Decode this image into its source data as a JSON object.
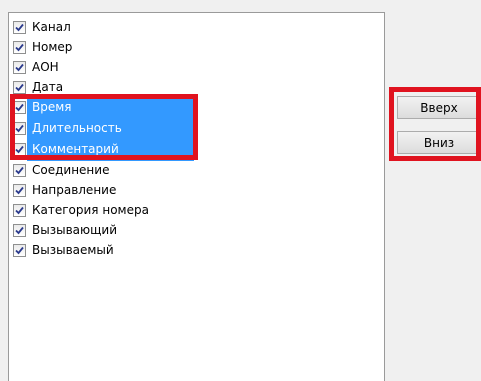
{
  "list": {
    "items": [
      {
        "label": "Канал",
        "checked": true,
        "selected": false
      },
      {
        "label": "Номер",
        "checked": true,
        "selected": false
      },
      {
        "label": "АОН",
        "checked": true,
        "selected": false
      },
      {
        "label": "Дата",
        "checked": true,
        "selected": false
      },
      {
        "label": "Время",
        "checked": true,
        "selected": true
      },
      {
        "label": "Длительность",
        "checked": true,
        "selected": true
      },
      {
        "label": "Комментарий",
        "checked": true,
        "selected": true
      },
      {
        "label": "Соединение",
        "checked": true,
        "selected": false
      },
      {
        "label": "Направление",
        "checked": true,
        "selected": false
      },
      {
        "label": "Категория номера",
        "checked": true,
        "selected": false
      },
      {
        "label": "Вызывающий",
        "checked": true,
        "selected": false
      },
      {
        "label": "Вызываемый",
        "checked": true,
        "selected": false
      }
    ]
  },
  "buttons": {
    "up_label": "Вверх",
    "down_label": "Вниз"
  },
  "colors": {
    "selection": "#3399ff",
    "highlight_frame": "#e0131f",
    "check_mark": "#2a3a8c"
  }
}
